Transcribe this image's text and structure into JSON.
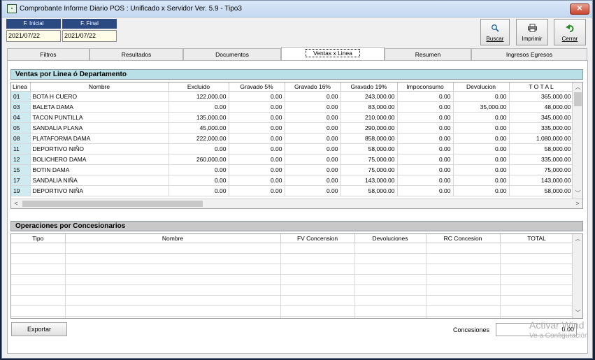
{
  "window": {
    "title": "Comprobante Informe Diario POS : Unificado x Servidor  Ver. 5.9 - Tipo3",
    "close_label": "✕"
  },
  "dates": {
    "start_label": "F. Inicial",
    "end_label": "F. Final",
    "start_value": "2021/07/22",
    "end_value": "2021/07/22"
  },
  "toolbar": {
    "search_label": "Buscar",
    "print_label": "Imprimir",
    "close_label": "Cerrar"
  },
  "tabs": [
    {
      "label": "Filtros"
    },
    {
      "label": "Resultados"
    },
    {
      "label": "Documentos"
    },
    {
      "label": "Ventas x Linea",
      "active": true
    },
    {
      "label": "Resumen"
    },
    {
      "label": "Ingresos Egresos"
    }
  ],
  "ventas": {
    "title": "Ventas por Linea ó Departamento",
    "columns": [
      "Linea",
      "Nombre",
      "Excluido",
      "Gravado 5%",
      "Gravado 16%",
      "Gravado 19%",
      "Impoconsumo",
      "Devolucion",
      "T O T A L"
    ],
    "rows": [
      [
        "01",
        "BOTA H CUERO",
        "122,000.00",
        "0.00",
        "0.00",
        "243,000.00",
        "0.00",
        "0.00",
        "365,000.00"
      ],
      [
        "03",
        "BALETA DAMA",
        "0.00",
        "0.00",
        "0.00",
        "83,000.00",
        "0.00",
        "35,000.00",
        "48,000.00"
      ],
      [
        "04",
        "TACON PUNTILLA",
        "135,000.00",
        "0.00",
        "0.00",
        "210,000.00",
        "0.00",
        "0.00",
        "345,000.00"
      ],
      [
        "05",
        "SANDALIA PLANA",
        "45,000.00",
        "0.00",
        "0.00",
        "290,000.00",
        "0.00",
        "0.00",
        "335,000.00"
      ],
      [
        "08",
        "PLATAFORMA DAMA",
        "222,000.00",
        "0.00",
        "0.00",
        "858,000.00",
        "0.00",
        "0.00",
        "1,080,000.00"
      ],
      [
        "11",
        "DEPORTIVO NIÑO",
        "0.00",
        "0.00",
        "0.00",
        "58,000.00",
        "0.00",
        "0.00",
        "58,000.00"
      ],
      [
        "12",
        "BOLICHERO DAMA",
        "260,000.00",
        "0.00",
        "0.00",
        "75,000.00",
        "0.00",
        "0.00",
        "335,000.00"
      ],
      [
        "15",
        "BOTIN DAMA",
        "0.00",
        "0.00",
        "0.00",
        "75,000.00",
        "0.00",
        "0.00",
        "75,000.00"
      ],
      [
        "17",
        "SANDALIA NIÑA",
        "0.00",
        "0.00",
        "0.00",
        "143,000.00",
        "0.00",
        "0.00",
        "143,000.00"
      ],
      [
        "19",
        "DEPORTIVO NIÑA",
        "0.00",
        "0.00",
        "0.00",
        "58,000.00",
        "0.00",
        "0.00",
        "58,000.00"
      ]
    ]
  },
  "concesionarios": {
    "title": "Operaciones por Concesionarios",
    "columns": [
      "Tipo",
      "Nombre",
      "FV Concension",
      "Devoluciones",
      "RC Concesion",
      "TOTAL"
    ],
    "empty_rows": 8
  },
  "footer": {
    "export_label": "Exportar",
    "concesiones_label": "Concesiones",
    "concesiones_value": "0.00"
  },
  "watermark": {
    "line1": "Activar Wind",
    "line2": "Ve a Configuración"
  },
  "colors": {
    "section_header_bg": "#b8e0e6",
    "section2_header_bg": "#c8c8c8",
    "code_cell_bg": "#cfeaf0",
    "date_header_bg": "#2b4a82",
    "date_value_bg": "#fffde8"
  }
}
